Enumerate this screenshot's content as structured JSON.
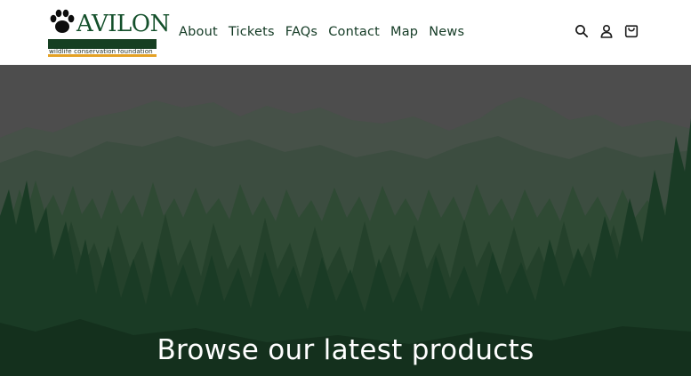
{
  "logo": {
    "wordmark": "AVILON",
    "tagline": "wildlife conservation foundation",
    "colors": {
      "wordmark": "#14502b",
      "band": "#163f22",
      "stripe": "#e4a125"
    }
  },
  "nav": {
    "items": [
      {
        "label": "About"
      },
      {
        "label": "Tickets"
      },
      {
        "label": "FAQs"
      },
      {
        "label": "Contact"
      },
      {
        "label": "Map"
      },
      {
        "label": "News"
      }
    ]
  },
  "header_icons": [
    "search-icon",
    "account-icon",
    "cart-icon"
  ],
  "hero": {
    "title": "Browse our latest products",
    "colors": {
      "sky": "#4d4d4d",
      "forest": "#1a3b25",
      "title": "#ffffff"
    }
  }
}
